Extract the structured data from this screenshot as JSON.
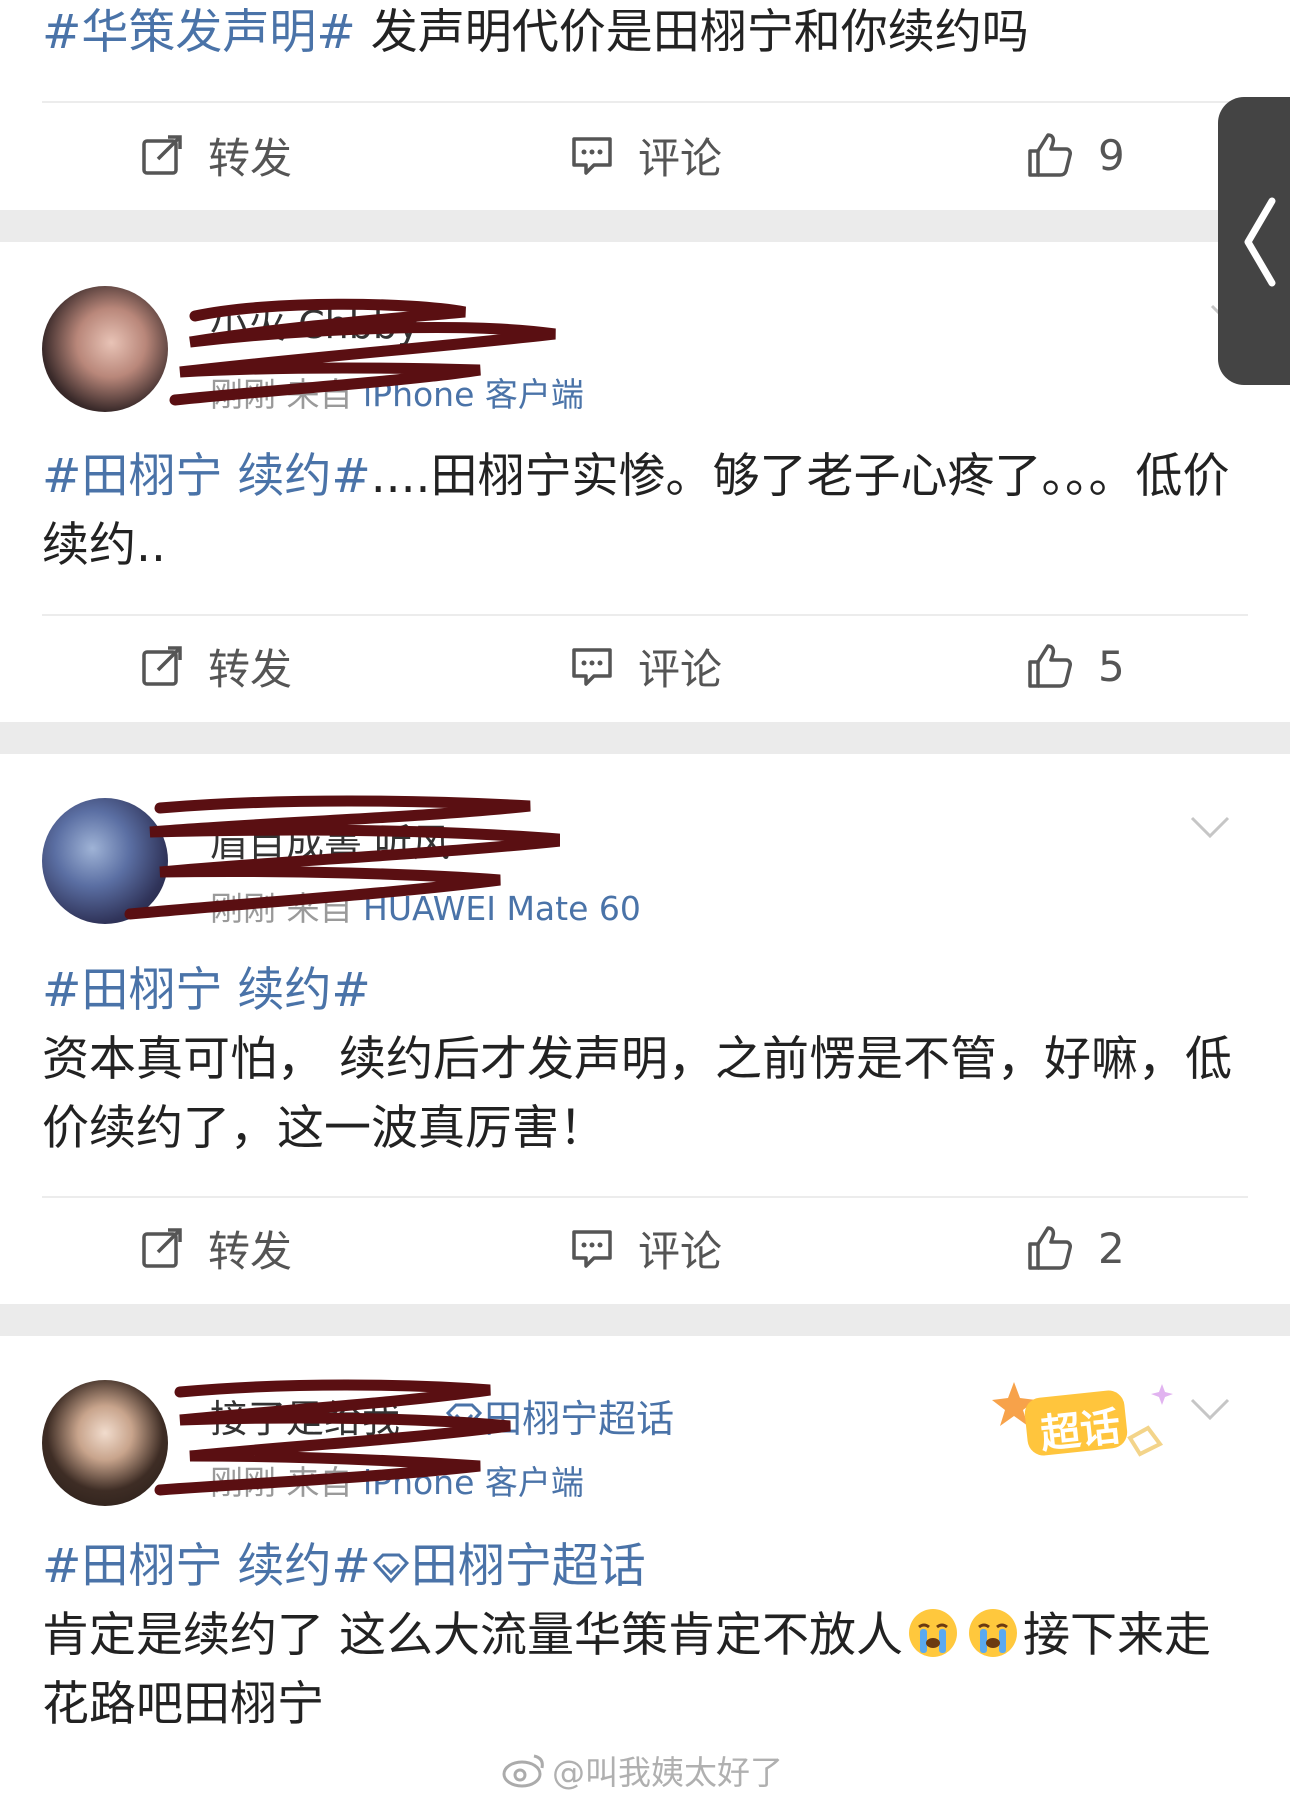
{
  "posts": [
    {
      "text_tag": "#华策发声明#",
      "text_body": " 发声明代价是田栩宁和你续约吗",
      "repost_label": "转发",
      "comment_label": "评论",
      "likes": "9"
    },
    {
      "username": "小火 Chbby",
      "time": "刚刚",
      "from": "来自",
      "source": "iPhone 客户端",
      "text_tag": "#田栩宁 续约#",
      "text_body": "....田栩宁实惨。够了老子心疼了。。。低价续约..",
      "repost_label": "转发",
      "comment_label": "评论",
      "likes": "5"
    },
    {
      "username": "眉目成書 听风",
      "time": "刚刚",
      "from": "来自",
      "source": "HUAWEI Mate 60",
      "text_tag": "#田栩宁 续约#",
      "text_body": "资本真可怕， 续约后才发声明，之前愣是不管，好嘛，低价续约了，这一波真厉害！",
      "repost_label": "转发",
      "comment_label": "评论",
      "likes": "2"
    },
    {
      "username": "接了是给我",
      "supertopic": "田栩宁超话",
      "badge": "超话",
      "time": "刚刚",
      "from": "来自",
      "source": "iPhone 客户端",
      "text_tag": "#田栩宁 续约#",
      "text_tag2": "田栩宁超话",
      "text_body_a": "肯定是续约了 这么大流量华策肯定不放人",
      "text_body_b": "接下来走花路吧田栩宁"
    }
  ],
  "watermark": "@叫我姨太好了",
  "icons": [
    "repost-icon",
    "comment-icon",
    "like-icon",
    "chevron-down-icon",
    "chevron-left-icon",
    "crying-emoji-icon",
    "supertopic-diamond-icon",
    "weibo-logo-icon"
  ],
  "colors": {
    "link": "#4a73a8",
    "background": "#ebebeb",
    "scribble": "#5a0f12"
  }
}
